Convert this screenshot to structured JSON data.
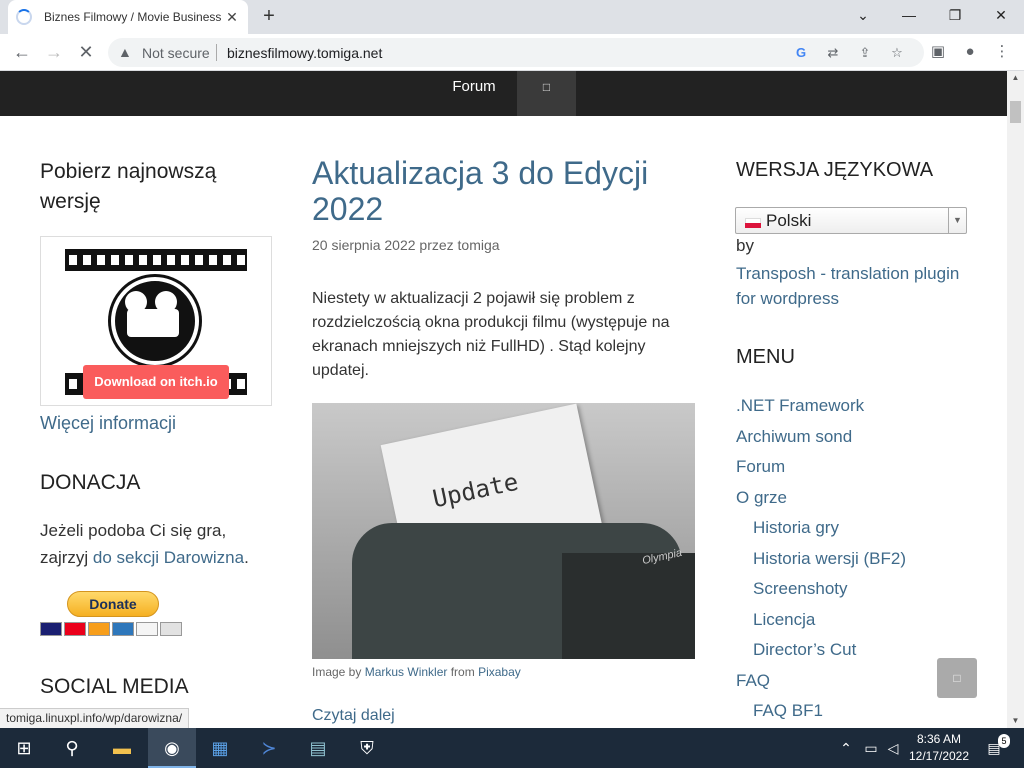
{
  "browser": {
    "tab_title": "Biznes Filmowy / Movie Business",
    "tab_close": "✕",
    "new_tab": "+",
    "not_secure": "Not secure",
    "url": "biznesfilmowy.tomiga.net"
  },
  "nav": {
    "forum": "Forum",
    "search_icon": "□"
  },
  "left": {
    "download_title": "Pobierz najnowszą wersję",
    "itch_button": "Download on itch.io",
    "more_info": "Więcej informacji",
    "donation_title": "DONACJA",
    "donation_text": "Jeżeli podoba Ci się gra, zajrzyj ",
    "donation_link": "do sekcji Darowizna",
    "donation_end": ".",
    "donate_button": "Donate",
    "social_title": "SOCIAL MEDIA",
    "status_url": "tomiga.linuxpl.info/wp/darowizna/"
  },
  "post": {
    "title": "Aktualizacja 3 do Edycji 2022",
    "meta": "20 sierpnia 2022 przez tomiga",
    "body": "Niestety w aktualizacji 2 pojawił się problem z rozdzielczością okna produkcji filmu (występuje na ekranach mniejszych niż FullHD) . Stąd kolejny updatej.",
    "image_word": "Update",
    "image_brand": "Olympia",
    "caption_prefix": "Image by ",
    "caption_author": "Markus Winkler",
    "caption_mid": " from ",
    "caption_source": "Pixabay",
    "read_more": "Czytaj dalej"
  },
  "right": {
    "lang_title": "WERSJA JĘZYKOWA",
    "lang_value": "Polski",
    "by": "by",
    "transposh": "Transposh - translation plugin for wordpress",
    "menu_title": "MENU",
    "menu_items": [
      {
        "label": ".NET Framework",
        "sub": false
      },
      {
        "label": "Archiwum sond",
        "sub": false
      },
      {
        "label": "Forum",
        "sub": false
      },
      {
        "label": "O grze",
        "sub": false
      },
      {
        "label": "Historia gry",
        "sub": true
      },
      {
        "label": "Historia wersji (BF2)",
        "sub": true
      },
      {
        "label": "Screenshoty",
        "sub": true
      },
      {
        "label": "Licencja",
        "sub": true
      },
      {
        "label": "Director’s Cut",
        "sub": true
      },
      {
        "label": "FAQ",
        "sub": false
      },
      {
        "label": "FAQ BF1",
        "sub": true
      }
    ],
    "to_top_icon": "□"
  },
  "taskbar": {
    "time": "8:36 AM",
    "date": "12/17/2022",
    "notif_count": "5"
  }
}
